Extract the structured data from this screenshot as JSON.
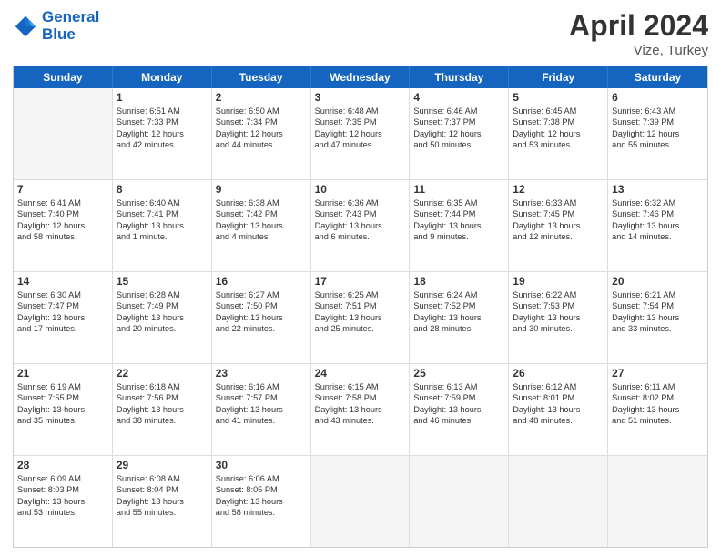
{
  "header": {
    "logo_line1": "General",
    "logo_line2": "Blue",
    "main_title": "April 2024",
    "subtitle": "Vize, Turkey"
  },
  "days": [
    "Sunday",
    "Monday",
    "Tuesday",
    "Wednesday",
    "Thursday",
    "Friday",
    "Saturday"
  ],
  "weeks": [
    [
      {
        "day": "",
        "empty": true
      },
      {
        "day": "1",
        "l1": "Sunrise: 6:51 AM",
        "l2": "Sunset: 7:33 PM",
        "l3": "Daylight: 12 hours",
        "l4": "and 42 minutes."
      },
      {
        "day": "2",
        "l1": "Sunrise: 6:50 AM",
        "l2": "Sunset: 7:34 PM",
        "l3": "Daylight: 12 hours",
        "l4": "and 44 minutes."
      },
      {
        "day": "3",
        "l1": "Sunrise: 6:48 AM",
        "l2": "Sunset: 7:35 PM",
        "l3": "Daylight: 12 hours",
        "l4": "and 47 minutes."
      },
      {
        "day": "4",
        "l1": "Sunrise: 6:46 AM",
        "l2": "Sunset: 7:37 PM",
        "l3": "Daylight: 12 hours",
        "l4": "and 50 minutes."
      },
      {
        "day": "5",
        "l1": "Sunrise: 6:45 AM",
        "l2": "Sunset: 7:38 PM",
        "l3": "Daylight: 12 hours",
        "l4": "and 53 minutes."
      },
      {
        "day": "6",
        "l1": "Sunrise: 6:43 AM",
        "l2": "Sunset: 7:39 PM",
        "l3": "Daylight: 12 hours",
        "l4": "and 55 minutes."
      }
    ],
    [
      {
        "day": "7",
        "l1": "Sunrise: 6:41 AM",
        "l2": "Sunset: 7:40 PM",
        "l3": "Daylight: 12 hours",
        "l4": "and 58 minutes."
      },
      {
        "day": "8",
        "l1": "Sunrise: 6:40 AM",
        "l2": "Sunset: 7:41 PM",
        "l3": "Daylight: 13 hours",
        "l4": "and 1 minute."
      },
      {
        "day": "9",
        "l1": "Sunrise: 6:38 AM",
        "l2": "Sunset: 7:42 PM",
        "l3": "Daylight: 13 hours",
        "l4": "and 4 minutes."
      },
      {
        "day": "10",
        "l1": "Sunrise: 6:36 AM",
        "l2": "Sunset: 7:43 PM",
        "l3": "Daylight: 13 hours",
        "l4": "and 6 minutes."
      },
      {
        "day": "11",
        "l1": "Sunrise: 6:35 AM",
        "l2": "Sunset: 7:44 PM",
        "l3": "Daylight: 13 hours",
        "l4": "and 9 minutes."
      },
      {
        "day": "12",
        "l1": "Sunrise: 6:33 AM",
        "l2": "Sunset: 7:45 PM",
        "l3": "Daylight: 13 hours",
        "l4": "and 12 minutes."
      },
      {
        "day": "13",
        "l1": "Sunrise: 6:32 AM",
        "l2": "Sunset: 7:46 PM",
        "l3": "Daylight: 13 hours",
        "l4": "and 14 minutes."
      }
    ],
    [
      {
        "day": "14",
        "l1": "Sunrise: 6:30 AM",
        "l2": "Sunset: 7:47 PM",
        "l3": "Daylight: 13 hours",
        "l4": "and 17 minutes."
      },
      {
        "day": "15",
        "l1": "Sunrise: 6:28 AM",
        "l2": "Sunset: 7:49 PM",
        "l3": "Daylight: 13 hours",
        "l4": "and 20 minutes."
      },
      {
        "day": "16",
        "l1": "Sunrise: 6:27 AM",
        "l2": "Sunset: 7:50 PM",
        "l3": "Daylight: 13 hours",
        "l4": "and 22 minutes."
      },
      {
        "day": "17",
        "l1": "Sunrise: 6:25 AM",
        "l2": "Sunset: 7:51 PM",
        "l3": "Daylight: 13 hours",
        "l4": "and 25 minutes."
      },
      {
        "day": "18",
        "l1": "Sunrise: 6:24 AM",
        "l2": "Sunset: 7:52 PM",
        "l3": "Daylight: 13 hours",
        "l4": "and 28 minutes."
      },
      {
        "day": "19",
        "l1": "Sunrise: 6:22 AM",
        "l2": "Sunset: 7:53 PM",
        "l3": "Daylight: 13 hours",
        "l4": "and 30 minutes."
      },
      {
        "day": "20",
        "l1": "Sunrise: 6:21 AM",
        "l2": "Sunset: 7:54 PM",
        "l3": "Daylight: 13 hours",
        "l4": "and 33 minutes."
      }
    ],
    [
      {
        "day": "21",
        "l1": "Sunrise: 6:19 AM",
        "l2": "Sunset: 7:55 PM",
        "l3": "Daylight: 13 hours",
        "l4": "and 35 minutes."
      },
      {
        "day": "22",
        "l1": "Sunrise: 6:18 AM",
        "l2": "Sunset: 7:56 PM",
        "l3": "Daylight: 13 hours",
        "l4": "and 38 minutes."
      },
      {
        "day": "23",
        "l1": "Sunrise: 6:16 AM",
        "l2": "Sunset: 7:57 PM",
        "l3": "Daylight: 13 hours",
        "l4": "and 41 minutes."
      },
      {
        "day": "24",
        "l1": "Sunrise: 6:15 AM",
        "l2": "Sunset: 7:58 PM",
        "l3": "Daylight: 13 hours",
        "l4": "and 43 minutes."
      },
      {
        "day": "25",
        "l1": "Sunrise: 6:13 AM",
        "l2": "Sunset: 7:59 PM",
        "l3": "Daylight: 13 hours",
        "l4": "and 46 minutes."
      },
      {
        "day": "26",
        "l1": "Sunrise: 6:12 AM",
        "l2": "Sunset: 8:01 PM",
        "l3": "Daylight: 13 hours",
        "l4": "and 48 minutes."
      },
      {
        "day": "27",
        "l1": "Sunrise: 6:11 AM",
        "l2": "Sunset: 8:02 PM",
        "l3": "Daylight: 13 hours",
        "l4": "and 51 minutes."
      }
    ],
    [
      {
        "day": "28",
        "l1": "Sunrise: 6:09 AM",
        "l2": "Sunset: 8:03 PM",
        "l3": "Daylight: 13 hours",
        "l4": "and 53 minutes."
      },
      {
        "day": "29",
        "l1": "Sunrise: 6:08 AM",
        "l2": "Sunset: 8:04 PM",
        "l3": "Daylight: 13 hours",
        "l4": "and 55 minutes."
      },
      {
        "day": "30",
        "l1": "Sunrise: 6:06 AM",
        "l2": "Sunset: 8:05 PM",
        "l3": "Daylight: 13 hours",
        "l4": "and 58 minutes."
      },
      {
        "day": "",
        "empty": true
      },
      {
        "day": "",
        "empty": true
      },
      {
        "day": "",
        "empty": true
      },
      {
        "day": "",
        "empty": true
      }
    ]
  ]
}
